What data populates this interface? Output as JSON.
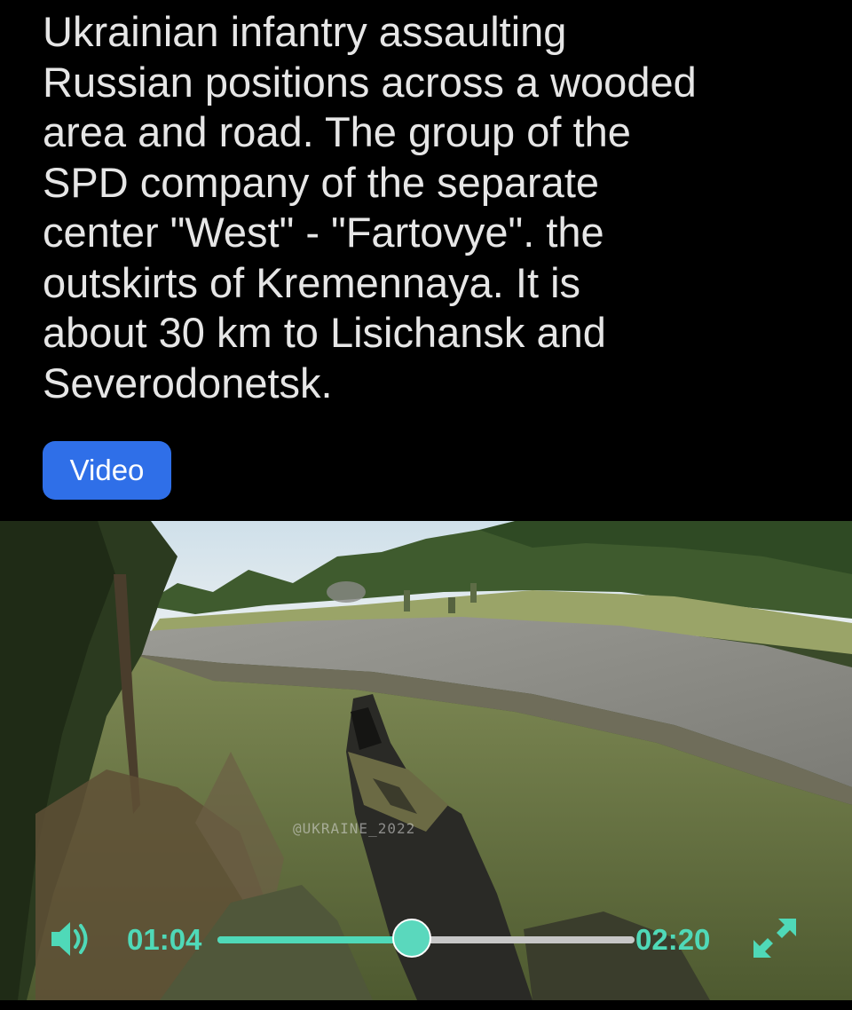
{
  "post": {
    "caption": "Ukrainian infantry assaulting\nRussian positions across a wooded\narea and road. The group of the\nSPD company of the separate\ncenter \"West\" - \"Fartovye\". the\noutskirts of Kremennaya. It is\nabout 30 km to Lisichansk and\nSeverodonetsk.",
    "tag_label": "Video"
  },
  "player": {
    "current_time": "01:04",
    "total_time": "02:20",
    "progress": 0.465,
    "watermark": "@UKRAINE_2022",
    "accent_color": "#4fd9b8",
    "volume_icon": "speaker-icon",
    "fullscreen_icon": "expand-arrows-icon"
  }
}
